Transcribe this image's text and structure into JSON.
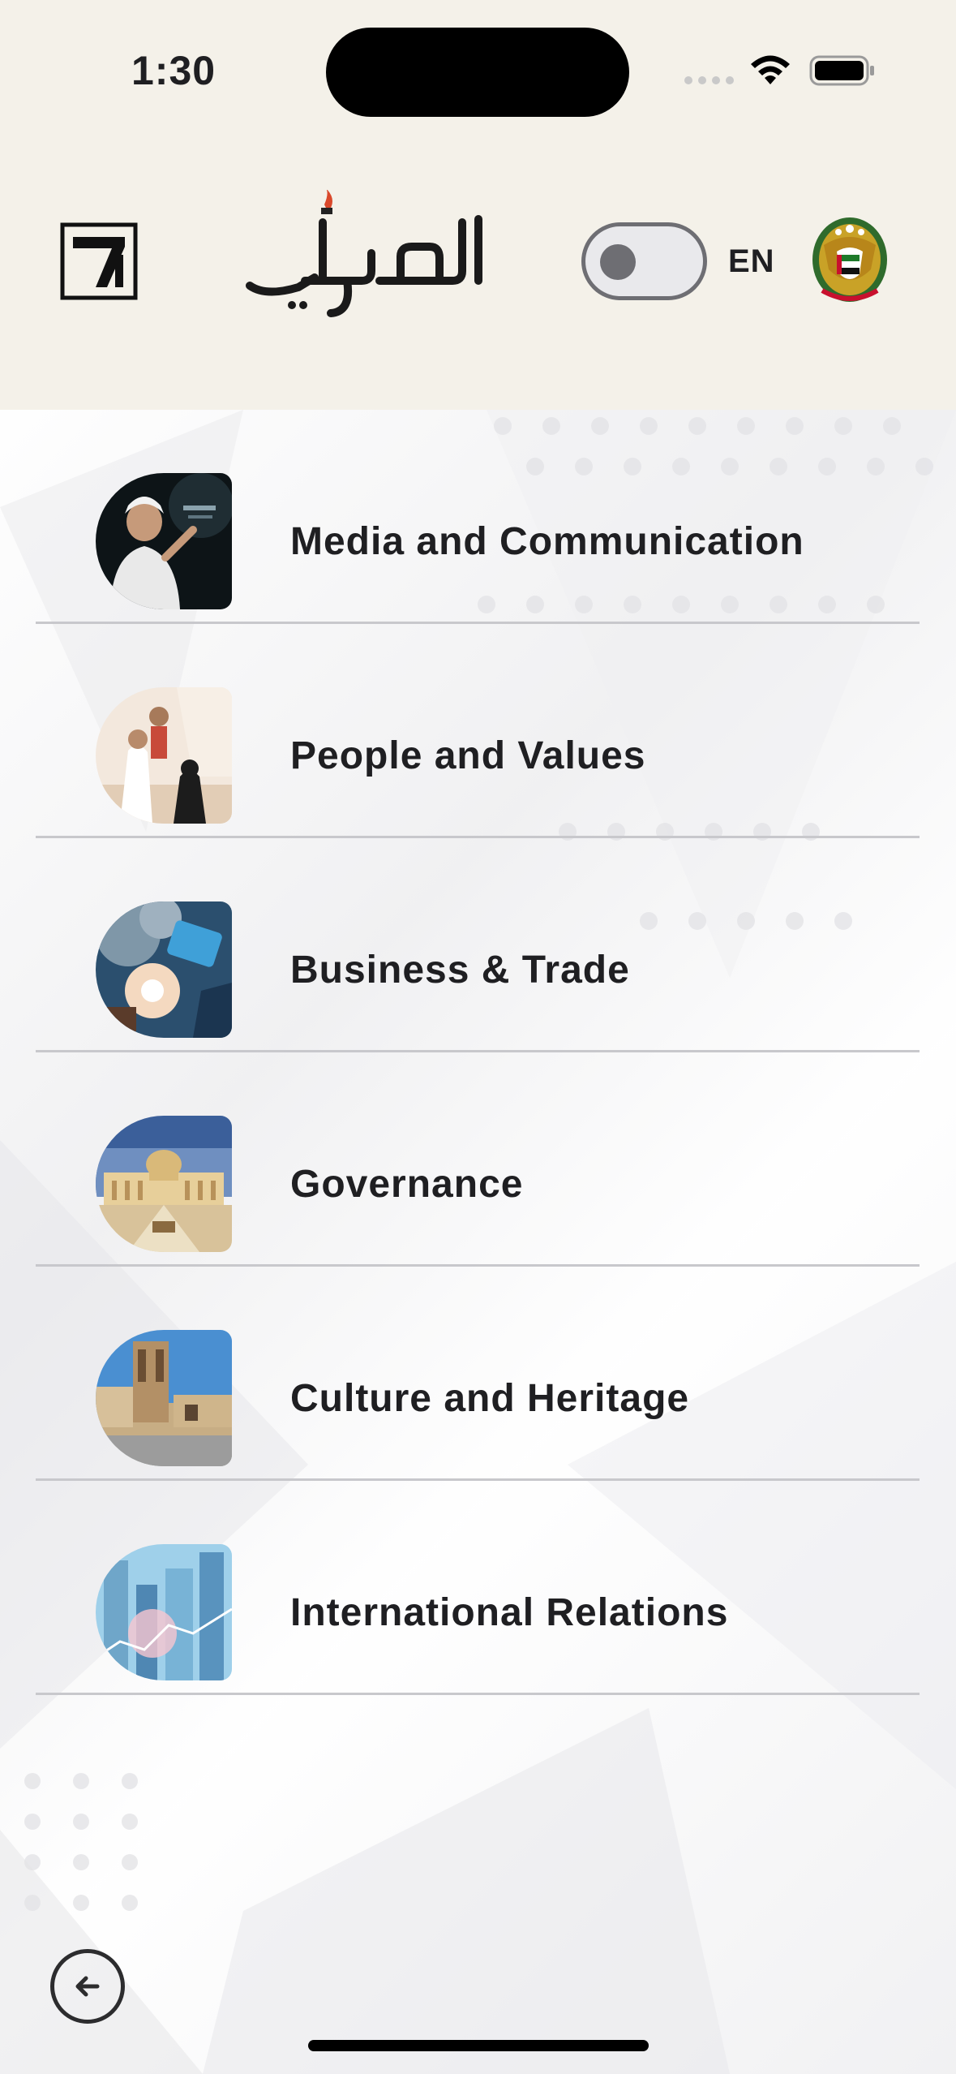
{
  "status_bar": {
    "time": "1:30"
  },
  "app_bar": {
    "language_label": "EN",
    "theme_toggle_on": false
  },
  "menu": {
    "items": [
      {
        "label": "Media and Communication",
        "icon": "media-image"
      },
      {
        "label": "People and Values",
        "icon": "people-image"
      },
      {
        "label": "Business & Trade",
        "icon": "business-image"
      },
      {
        "label": "Governance",
        "icon": "governance-image"
      },
      {
        "label": "Culture and Heritage",
        "icon": "culture-image"
      },
      {
        "label": "International Relations",
        "icon": "international-image"
      }
    ]
  },
  "colors": {
    "header_bg": "#f4f1e9",
    "text": "#1f1f22",
    "divider": "#c8c8cc",
    "toggle": "#6e6e73",
    "logo_flame": "#d9482b"
  }
}
